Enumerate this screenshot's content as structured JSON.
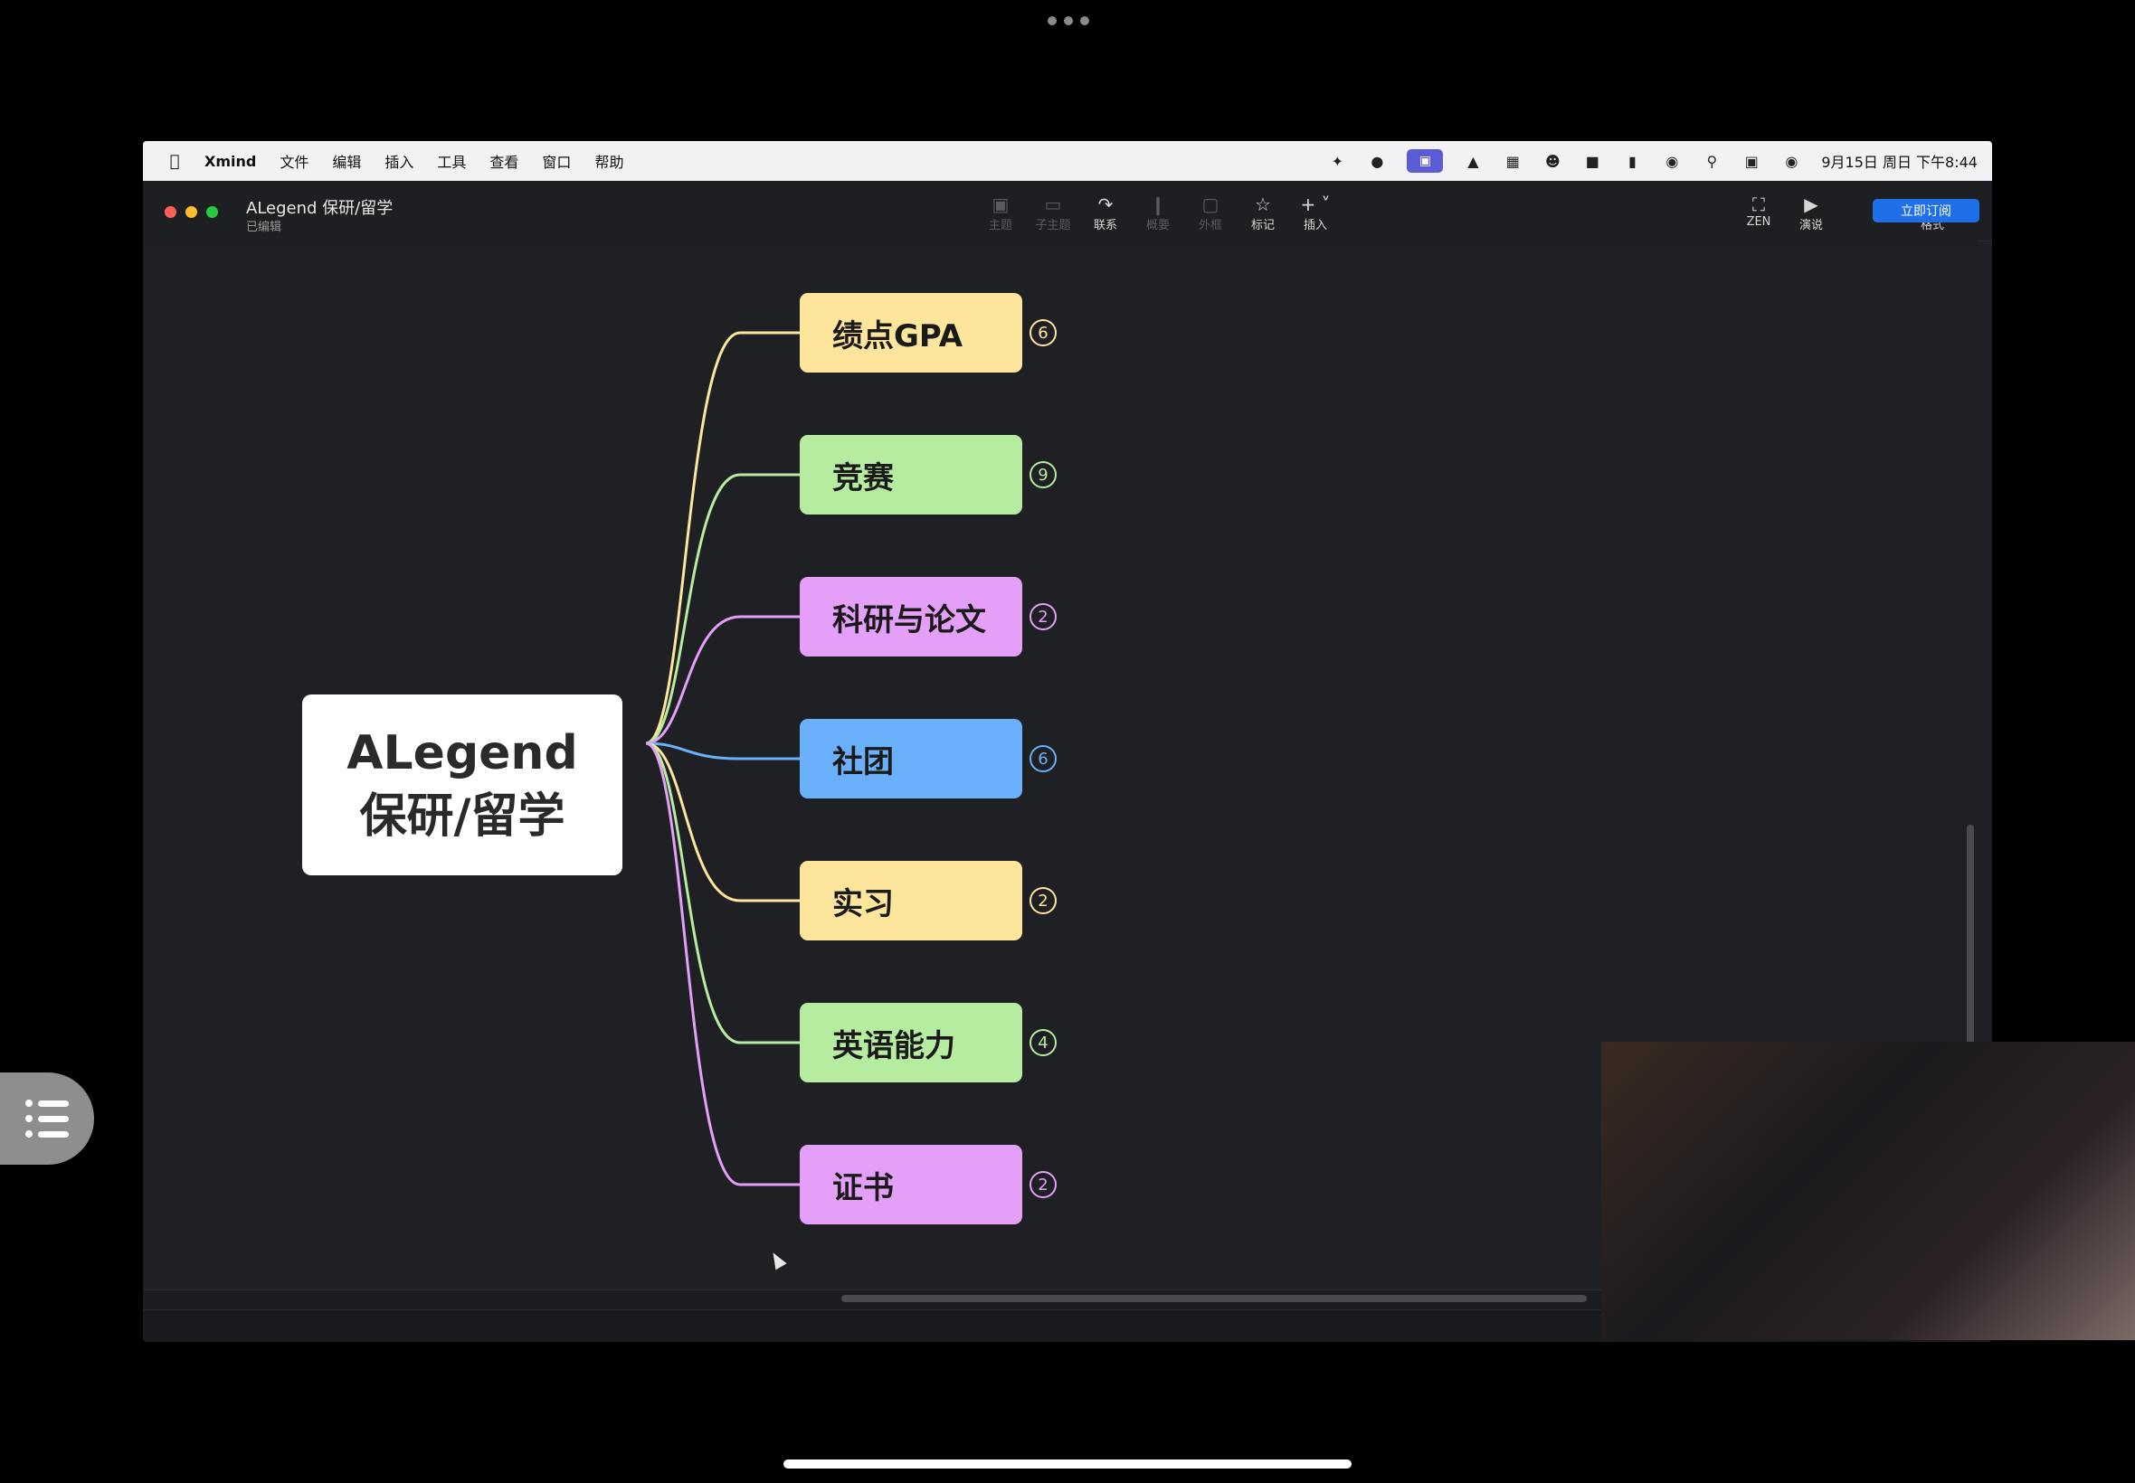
{
  "menubar": {
    "app_name": "Xmind",
    "items": [
      "文件",
      "编辑",
      "插入",
      "工具",
      "查看",
      "窗口",
      "帮助"
    ],
    "clock": "9月15日 周日 下午8:44"
  },
  "window": {
    "title": "ALegend 保研/留学",
    "subtitle": "已编辑",
    "toolbar": {
      "topic": "主题",
      "subtopic": "子主题",
      "relation": "联系",
      "summary": "概要",
      "boundary": "外框",
      "marker": "标记",
      "insert": "插入",
      "zen": "ZEN",
      "present": "演说",
      "format": "格式",
      "subscribe": "立即订阅"
    }
  },
  "mindmap": {
    "root": {
      "line1": "ALegend",
      "line2": "保研/留学"
    },
    "branches": [
      {
        "label": "绩点GPA",
        "count": "6",
        "color": "#fde69c"
      },
      {
        "label": "竞赛",
        "count": "9",
        "color": "#b6ec9f"
      },
      {
        "label": "科研与论文",
        "count": "2",
        "color": "#e49ff9"
      },
      {
        "label": "社团",
        "count": "6",
        "color": "#6ab0fb"
      },
      {
        "label": "实习",
        "count": "2",
        "color": "#fde69c"
      },
      {
        "label": "英语能力",
        "count": "4",
        "color": "#b6ec9f"
      },
      {
        "label": "证书",
        "count": "2",
        "color": "#e49ff9"
      }
    ]
  }
}
